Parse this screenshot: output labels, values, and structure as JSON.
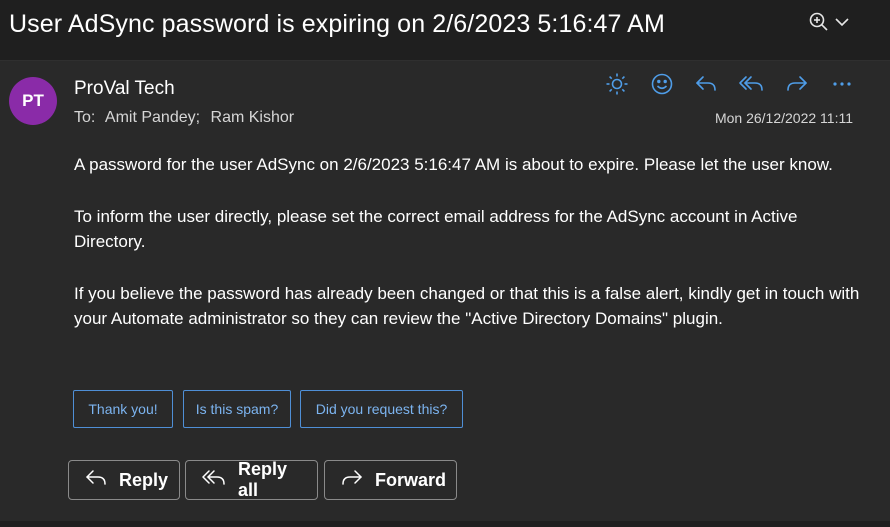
{
  "subject": "User AdSync password is expiring on 2/6/2023 5:16:47 AM",
  "message": {
    "avatar_initials": "PT",
    "sender": "ProVal Tech",
    "to_label": "To:",
    "recipients": [
      "Amit Pandey;",
      "Ram Kishor"
    ],
    "date": "Mon 26/12/2022 11:11",
    "paragraphs": [
      "A password for the user AdSync on 2/6/2023 5:16:47 AM is about to expire. Please let the user know.",
      "To inform the user directly, please set the correct email address for the AdSync account in Active Directory.",
      "If you believe the password has already been changed or that this is a false alert, kindly get in touch with your Automate administrator so they can review the \"Active Directory Domains\" plugin."
    ]
  },
  "suggested_replies": [
    "Thank you!",
    "Is this spam?",
    "Did you request this?"
  ],
  "reply_buttons": {
    "reply": "Reply",
    "reply_all": "Reply all",
    "forward": "Forward"
  },
  "colors": {
    "accent": "#4f9de8",
    "avatar": "#8a2ba8",
    "background": "#1f1f1f",
    "card": "#292929"
  },
  "icons": [
    "zoom-icon",
    "chevron-down-icon",
    "sun-icon",
    "emoji-icon",
    "reply-icon",
    "reply-all-icon",
    "forward-icon",
    "more-icon"
  ]
}
